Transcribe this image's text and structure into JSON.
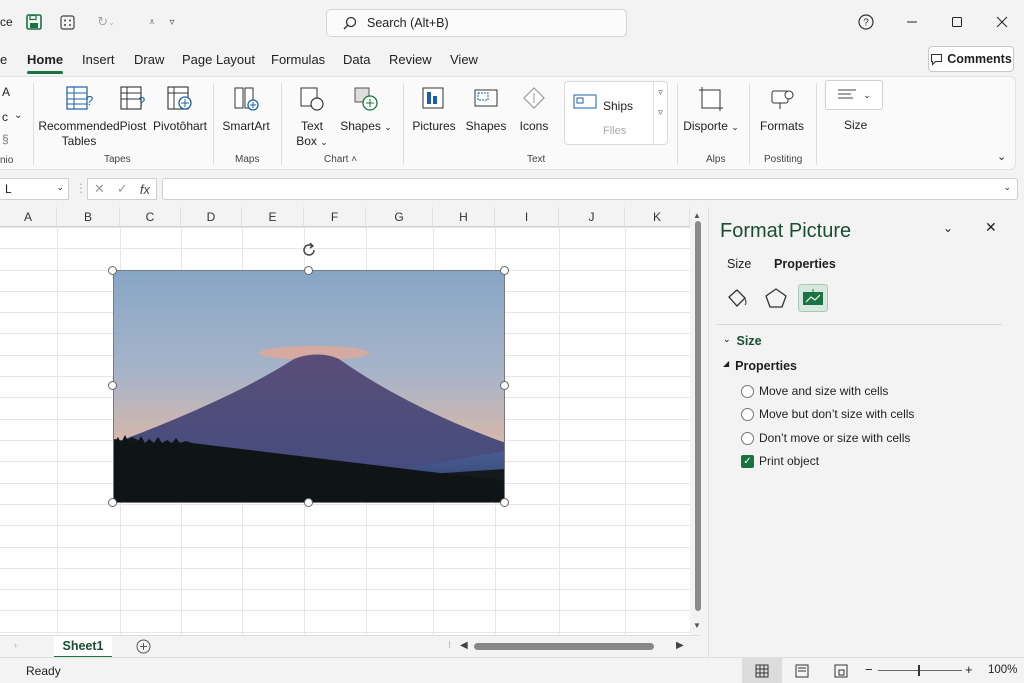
{
  "titlebar": {
    "app_fragment": "ce",
    "search_placeholder": "Search (Alt+B)"
  },
  "menu": {
    "tabs": [
      "e",
      "Home",
      "Insert",
      "Draw",
      "Page Layout",
      "Formulas",
      "Data",
      "Review",
      "View"
    ],
    "comments": "Comments"
  },
  "ribbon": {
    "left_fragments": [
      "A",
      "c",
      "nio"
    ],
    "recommended": [
      "Recommended",
      "Tables"
    ],
    "piost": "Piost",
    "pivotchart": "Pivotôhart",
    "smartart": "SmartArt",
    "textbox": [
      "Text",
      "Box"
    ],
    "shapes1": "Shapes",
    "pictures": "Pictures",
    "shapes2": "Shapes",
    "icons": "Icons",
    "ships": "Ships",
    "files": "Flles",
    "disporte": "Disporte",
    "formats": "Formats",
    "size": "Size",
    "groups": {
      "tapes": "Tapes",
      "maps": "Maps",
      "chart": "Chart ˄",
      "text": "Text",
      "alps": "Alps",
      "postiting": "Postiting"
    }
  },
  "formula_bar": {
    "namebox": "L",
    "fx": "fx"
  },
  "grid": {
    "columns": [
      "A",
      "B",
      "C",
      "D",
      "E",
      "F",
      "G",
      "H",
      "I",
      "J",
      "K"
    ]
  },
  "pane": {
    "title": "Format Picture",
    "tabs": [
      "Size",
      "Properties"
    ],
    "sections": {
      "size": "Size",
      "properties": "Properties"
    },
    "options": [
      {
        "label": "Move and size with cells",
        "type": "radio",
        "checked": false
      },
      {
        "label": "Move but don’t size with cells",
        "type": "radio",
        "checked": false
      },
      {
        "label": "Don’t move or size with cells",
        "type": "radio",
        "checked": false
      },
      {
        "label": "Print object",
        "type": "checkbox",
        "checked": true
      }
    ]
  },
  "sheets": {
    "active": "Sheet1"
  },
  "status": {
    "ready": "Ready",
    "zoom": "100%"
  },
  "colors": {
    "accent": "#1a7343",
    "pane_title": "#1a4d33"
  }
}
